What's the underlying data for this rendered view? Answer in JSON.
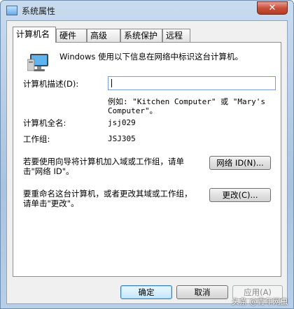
{
  "window": {
    "title": "系统属性",
    "close_glyph": "✕"
  },
  "tabs": [
    {
      "label": "计算机名",
      "active": true
    },
    {
      "label": "硬件",
      "active": false
    },
    {
      "label": "高级",
      "active": false
    },
    {
      "label": "系统保护",
      "active": false
    },
    {
      "label": "远程",
      "active": false
    }
  ],
  "panel": {
    "info_text": "Windows 使用以下信息在网络中标识这台计算机。",
    "description_label": "计算机描述(D):",
    "description_value": "",
    "example_line1": "例如: \"Kitchen Computer\" 或 \"Mary's",
    "example_line2": "Computer\"。",
    "fullname_label": "计算机全名:",
    "fullname_value": "jsj029",
    "workgroup_label": "工作组:",
    "workgroup_value": "JSJ305",
    "network_text_line1": "若要使用向导将计算机加入域或工作组，请单",
    "network_text_line2": "击\"网络 ID\"。",
    "network_button": "网络 ID(N)...",
    "rename_text_line1": "要重命名这台计算机，或者更改其域或工作组，",
    "rename_text_line2": "请单击\"更改\"。",
    "change_button": "更改(C)..."
  },
  "footer": {
    "ok": "确定",
    "cancel": "取消",
    "apply": "应用(A)"
  },
  "watermark": "头条 @青年网虫"
}
